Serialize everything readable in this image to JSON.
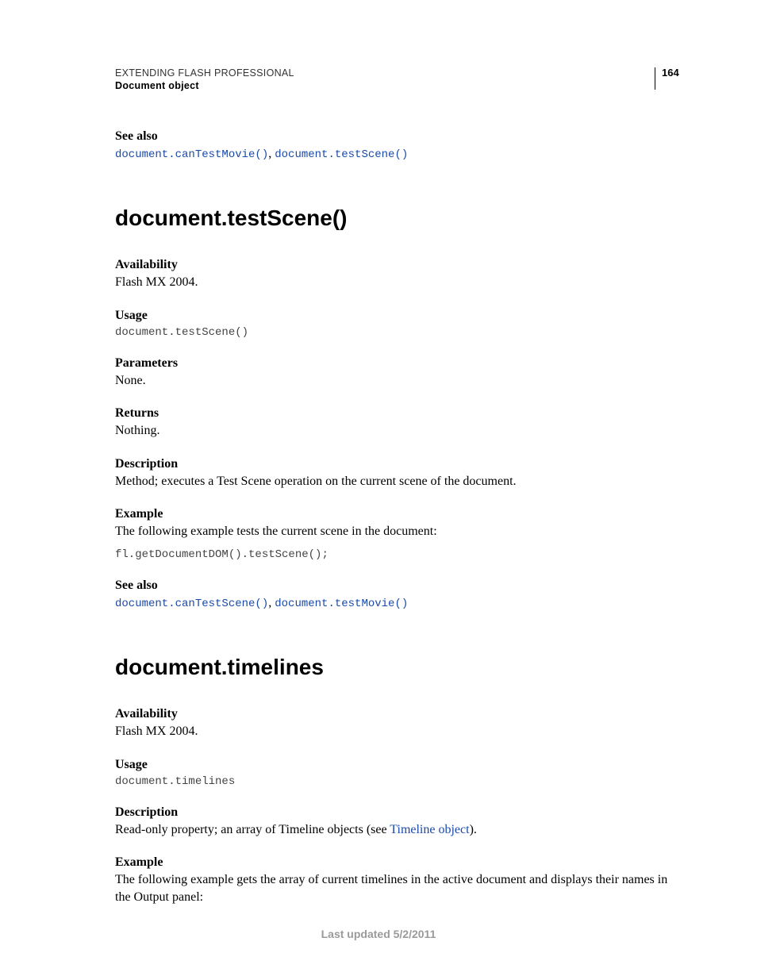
{
  "header": {
    "title": "EXTENDING FLASH PROFESSIONAL",
    "subtitle": "Document object",
    "page_number": "164"
  },
  "top": {
    "see_also_label": "See also",
    "link1": "document.canTestMovie()",
    "link2": "document.testScene()"
  },
  "section1": {
    "title": "document.testScene()",
    "availability_label": "Availability",
    "availability_text": "Flash MX 2004.",
    "usage_label": "Usage",
    "usage_code": "document.testScene()",
    "parameters_label": "Parameters",
    "parameters_text": "None.",
    "returns_label": "Returns",
    "returns_text": "Nothing.",
    "description_label": "Description",
    "description_text": "Method; executes a Test Scene operation on the current scene of the document.",
    "example_label": "Example",
    "example_text": "The following example tests the current scene in the document:",
    "example_code": "fl.getDocumentDOM().testScene();",
    "see_also_label": "See also",
    "see_also_link1": "document.canTestScene()",
    "see_also_link2": "document.testMovie()"
  },
  "section2": {
    "title": "document.timelines",
    "availability_label": "Availability",
    "availability_text": "Flash MX 2004.",
    "usage_label": "Usage",
    "usage_code": "document.timelines",
    "description_label": "Description",
    "description_text_pre": "Read-only property; an array of Timeline objects (see ",
    "description_link": "Timeline object",
    "description_text_post": ").",
    "example_label": "Example",
    "example_text": "The following example gets the array of current timelines in the active document and displays their names in the Output panel:"
  },
  "footer": "Last updated 5/2/2011"
}
